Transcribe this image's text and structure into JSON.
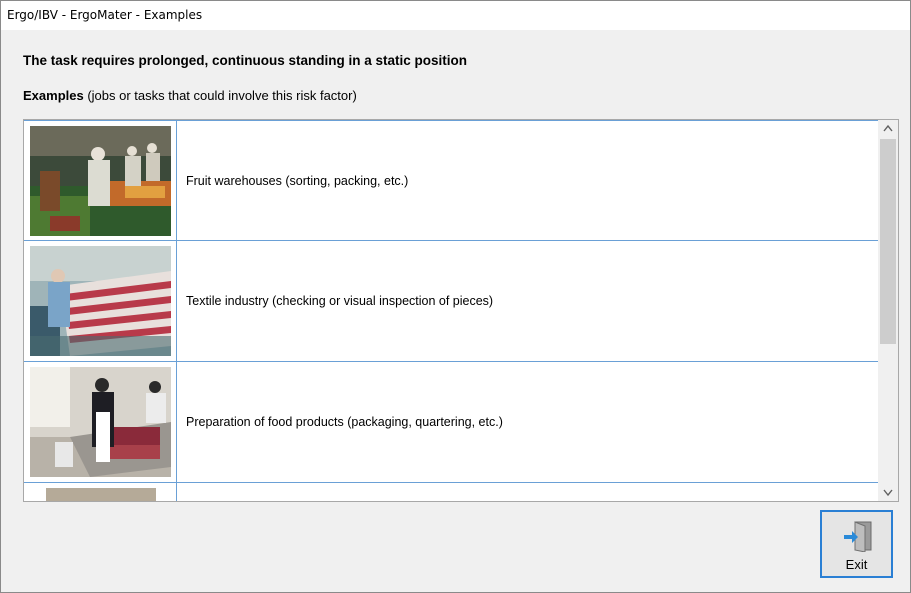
{
  "window": {
    "title": "Ergo/IBV - ErgoMater - Examples"
  },
  "heading": "The task requires prolonged, continuous standing in a static position",
  "subheading": {
    "bold": "Examples",
    "rest": " (jobs or tasks that could involve this risk factor)"
  },
  "examples": [
    {
      "label": "Fruit warehouses (sorting, packing, etc.)",
      "image": "fruit-warehouse-photo"
    },
    {
      "label": "Textile industry (checking or visual inspection of pieces)",
      "image": "textile-inspection-photo"
    },
    {
      "label": "Preparation of food products (packaging, quartering, etc.)",
      "image": "food-preparation-photo"
    },
    {
      "label": "",
      "image": "partial-photo"
    }
  ],
  "scrollbar": {
    "up_icon": "chevron-up-icon",
    "down_icon": "chevron-down-icon"
  },
  "exit_button": {
    "label": "Exit",
    "icon": "exit-door-icon"
  },
  "colors": {
    "row_border": "#6aa0d6",
    "button_border": "#2a7fd4",
    "window_bg": "#f0f0f0"
  }
}
